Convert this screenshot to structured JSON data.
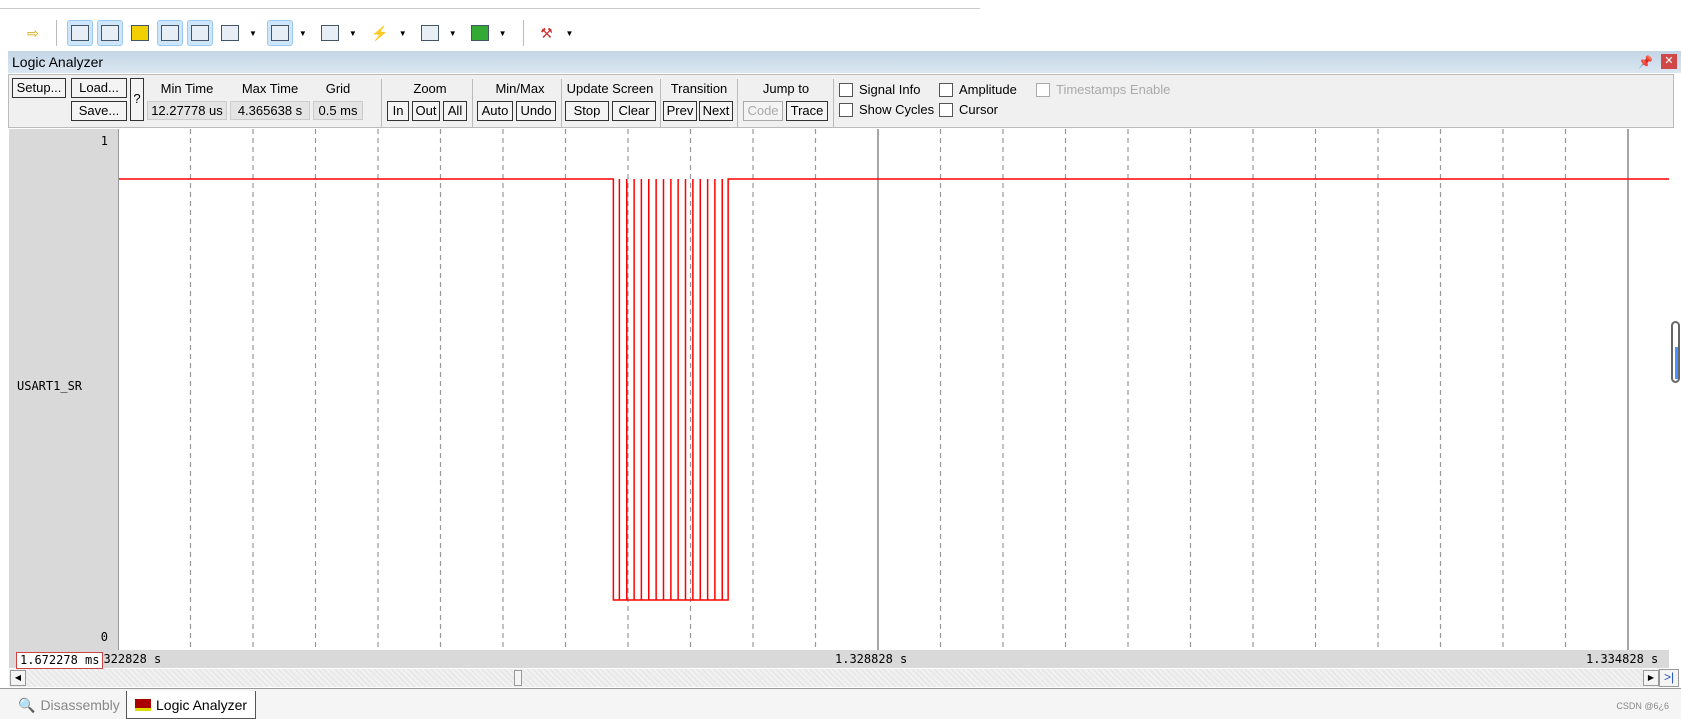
{
  "panel": {
    "title": "Logic Analyzer",
    "pin_icon": "pin-icon",
    "close_icon": "close-icon"
  },
  "controls": {
    "setup": "Setup...",
    "load": "Load...",
    "save": "Save...",
    "help": "?",
    "min_time_label": "Min Time",
    "min_time": "12.27778 us",
    "max_time_label": "Max Time",
    "max_time": "4.365638 s",
    "grid_label": "Grid",
    "grid": "0.5 ms",
    "zoom_label": "Zoom",
    "zoom_in": "In",
    "zoom_out": "Out",
    "zoom_all": "All",
    "minmax_label": "Min/Max",
    "auto": "Auto",
    "undo": "Undo",
    "update_label": "Update Screen",
    "stop": "Stop",
    "clear": "Clear",
    "transition_label": "Transition",
    "prev": "Prev",
    "next": "Next",
    "jump_label": "Jump to",
    "code": "Code",
    "trace": "Trace",
    "signal_info": "Signal Info",
    "show_cycles": "Show Cycles",
    "amplitude": "Amplitude",
    "cursor": "Cursor",
    "timestamps": "Timestamps Enable"
  },
  "signal": {
    "name": "USART1_SR",
    "max_label": "1",
    "min_label": "0"
  },
  "axis": {
    "cursor_readout": "1.672278 ms",
    "left": "1.322828 s",
    "mid": "1.328828 s",
    "right": "1.334828 s"
  },
  "tabs": [
    {
      "label": "Disassembly"
    },
    {
      "label": "Logic Analyzer"
    }
  ],
  "watermark": "CSDN @6¿6",
  "colors": {
    "signal": "#ff0000",
    "grid": "#888888"
  },
  "chart_data": {
    "type": "line",
    "series": [
      {
        "name": "USART1_SR",
        "low_start": 1.326711,
        "low_end": 1.327629,
        "spikes": [
          1.326759,
          1.326818,
          1.326877,
          1.326935,
          1.326994,
          1.327053,
          1.327112,
          1.327171,
          1.327229,
          1.327288,
          1.327347,
          1.327406,
          1.327465,
          1.327523,
          1.327582
        ]
      }
    ],
    "xlim": [
      1.322828,
      1.334828
    ],
    "ylim": [
      0,
      1
    ],
    "grid_step": 0.0005,
    "grid": true
  }
}
